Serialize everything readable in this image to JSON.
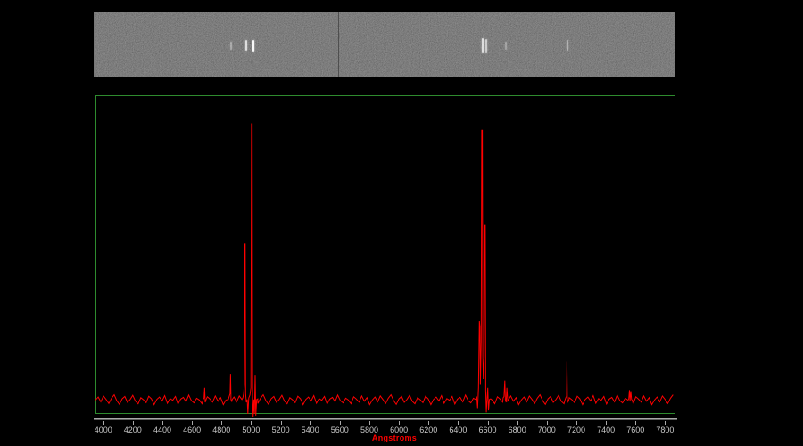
{
  "window": {
    "background_color": "#000000"
  },
  "strip": {
    "description_name": "2d-spectrum-strip",
    "background_mean_color": "#2c2c2c",
    "seam_wavelength": 5583,
    "line_color": "#ffffff",
    "lines": [
      {
        "wavelength": 4861,
        "brightness": 0.35,
        "height": 9
      },
      {
        "wavelength": 4959,
        "brightness": 0.75,
        "height": 12
      },
      {
        "wavelength": 5007,
        "brightness": 0.95,
        "height": 13
      },
      {
        "wavelength": 6563,
        "brightness": 0.75,
        "height": 16
      },
      {
        "wavelength": 6584,
        "brightness": 0.62,
        "height": 15
      },
      {
        "wavelength": 6716,
        "brightness": 0.3,
        "height": 9
      },
      {
        "wavelength": 7136,
        "brightness": 0.42,
        "height": 12
      }
    ]
  },
  "chart_data": {
    "type": "line",
    "title": "",
    "xlabel": "Angstroms",
    "ylabel": "",
    "y_axis_visible": false,
    "grid": false,
    "x_range": [
      3948,
      7870
    ],
    "x_ticks": [
      4000,
      4200,
      4400,
      4600,
      4800,
      5000,
      5200,
      5400,
      5600,
      5800,
      6000,
      6200,
      6400,
      6600,
      6800,
      7000,
      7200,
      7400,
      7600,
      7800
    ],
    "trace_color": "#ff0000",
    "border_color": "#2e8b2e",
    "axis_color": "#a8a8a8",
    "axis_shadow_color": "#5f5f5f",
    "tick_label_color": "#c8c8c8",
    "xlabel_color": "#ff0000",
    "continuum_level": 0.048,
    "noise_step_angstroms": 18,
    "noise_pattern": [
      0.0,
      0.01,
      -0.006,
      0.014,
      0.002,
      -0.012,
      0.006,
      0.018,
      -0.002,
      -0.015,
      0.004,
      0.012,
      -0.008,
      0.002,
      0.016,
      -0.004,
      -0.013,
      0.008,
      0.001,
      -0.009,
      0.013,
      0.004,
      -0.016,
      0.002,
      0.01,
      -0.003,
      0.015,
      -0.011,
      0.005,
      -0.001,
      0.012,
      -0.014,
      0.003,
      0.009,
      -0.006,
      0.017,
      -0.002,
      -0.01,
      0.006,
      0.0,
      -0.013,
      0.011,
      0.003,
      -0.007,
      0.014,
      -0.004,
      0.008,
      -0.016
    ],
    "features": [
      {
        "points": [
          [
            4676,
            0.05
          ],
          [
            4682,
            0.055
          ],
          [
            4686,
            0.09
          ],
          [
            4690,
            0.04
          ],
          [
            4696,
            0.05
          ]
        ]
      },
      {
        "points": [
          [
            4846,
            0.05
          ],
          [
            4852,
            0.06
          ],
          [
            4858,
            0.07
          ],
          [
            4861,
            0.138
          ],
          [
            4864,
            0.05
          ],
          [
            4869,
            0.042
          ],
          [
            4872,
            0.05
          ]
        ]
      },
      {
        "points": [
          [
            4944,
            0.055
          ],
          [
            4950,
            0.07
          ],
          [
            4954,
            0.1
          ],
          [
            4957,
            0.588
          ],
          [
            4960,
            0.588
          ],
          [
            4963,
            0.07
          ],
          [
            4968,
            0.04
          ],
          [
            4974,
            0.05
          ],
          [
            4978,
            0.0
          ],
          [
            4984,
            0.055
          ],
          [
            4992,
            0.065
          ],
          [
            4999,
            0.09
          ],
          [
            5003,
            1.0
          ],
          [
            5007,
            1.0
          ],
          [
            5010,
            0.06
          ],
          [
            5014,
            -0.012
          ],
          [
            5019,
            0.05
          ],
          [
            5023,
            0.0
          ],
          [
            5028,
            0.135
          ],
          [
            5032,
            -0.006
          ],
          [
            5038,
            0.05
          ],
          [
            5045,
            0.052
          ]
        ]
      },
      {
        "points": [
          [
            6518,
            0.05
          ],
          [
            6526,
            0.06
          ],
          [
            6532,
            0.02
          ],
          [
            6538,
            0.09
          ],
          [
            6544,
            0.32
          ],
          [
            6548,
            0.3
          ],
          [
            6551,
            0.1
          ],
          [
            6556,
            0.25
          ],
          [
            6560,
            0.978
          ],
          [
            6564,
            0.978
          ],
          [
            6567,
            0.2
          ],
          [
            6571,
            0.12
          ],
          [
            6576,
            0.2
          ],
          [
            6580,
            0.652
          ],
          [
            6584,
            0.652
          ],
          [
            6587,
            0.08
          ],
          [
            6591,
            0.005
          ],
          [
            6596,
            0.05
          ],
          [
            6601,
            0.09
          ],
          [
            6606,
            0.012
          ],
          [
            6612,
            0.05
          ],
          [
            6620,
            0.052
          ]
        ]
      },
      {
        "points": [
          [
            6705,
            0.055
          ],
          [
            6711,
            0.06
          ],
          [
            6716,
            0.115
          ],
          [
            6720,
            0.05
          ],
          [
            6725,
            0.04
          ],
          [
            6730,
            0.09
          ],
          [
            6736,
            0.045
          ],
          [
            6742,
            0.05
          ]
        ]
      },
      {
        "points": [
          [
            7124,
            0.05
          ],
          [
            7130,
            0.058
          ],
          [
            7134,
            0.06
          ],
          [
            7136,
            0.18
          ],
          [
            7139,
            0.05
          ],
          [
            7144,
            0.042
          ],
          [
            7150,
            0.05
          ]
        ]
      },
      {
        "points": [
          [
            7554,
            0.05
          ],
          [
            7559,
            0.082
          ],
          [
            7563,
            0.045
          ],
          [
            7568,
            0.078
          ],
          [
            7573,
            0.05
          ],
          [
            7578,
            0.048
          ]
        ]
      }
    ]
  }
}
